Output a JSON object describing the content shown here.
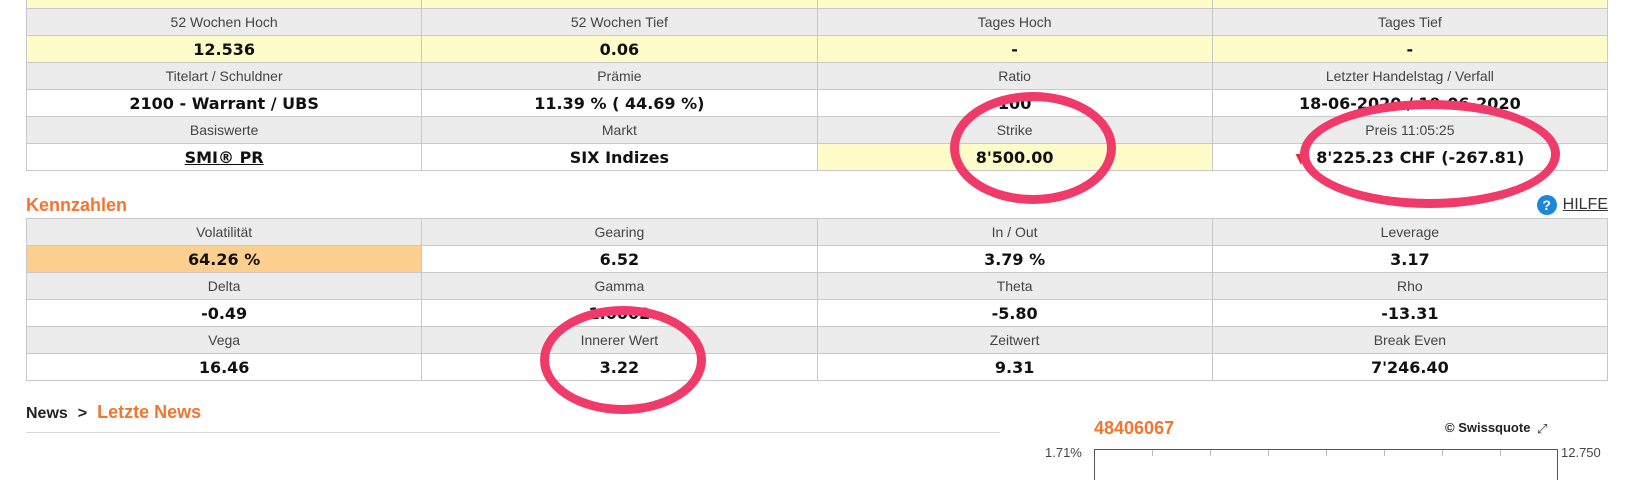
{
  "details": {
    "rows": [
      {
        "labels": [
          "52 Wochen Hoch",
          "52 Wochen Tief",
          "Tages Hoch",
          "Tages Tief"
        ],
        "values": [
          "12.536",
          "0.06",
          "-",
          "-"
        ]
      },
      {
        "labels": [
          "Titelart / Schuldner",
          "Prämie",
          "Ratio",
          "Letzter Handelstag / Verfall"
        ],
        "values": [
          "2100 - Warrant / UBS",
          "11.39 % ( 44.69 %)",
          "100",
          "18-06-2020 / 19-06-2020"
        ]
      },
      {
        "labels": [
          "Basiswerte",
          "Markt",
          "Strike",
          "Preis 11:05:25"
        ],
        "values": [
          "SMI® PR",
          "SIX Indizes",
          "8'500.00",
          "8'225.23 CHF (-267.81)"
        ]
      }
    ]
  },
  "kennzahlen": {
    "title": "Kennzahlen",
    "help_label": "HILFE",
    "help_icon": "question-icon",
    "rows": [
      {
        "labels": [
          "Volatilität",
          "Gearing",
          "In / Out",
          "Leverage"
        ],
        "values": [
          "64.26 %",
          "6.52",
          "3.79 %",
          "3.17"
        ]
      },
      {
        "labels": [
          "Delta",
          "Gamma",
          "Theta",
          "Rho"
        ],
        "values": [
          "-0.49",
          "1.0002",
          "-5.80",
          "-13.31"
        ]
      },
      {
        "labels": [
          "Vega",
          "Innerer Wert",
          "Zeitwert",
          "Break Even"
        ],
        "values": [
          "16.46",
          "3.22",
          "9.31",
          "7'246.40"
        ]
      }
    ]
  },
  "news": {
    "crumb": "News",
    "separator": ">",
    "current": "Letzte News"
  },
  "chart": {
    "id": "48406067",
    "source": "© Swissquote",
    "axis_left": "1.71%",
    "axis_right": "12.750"
  },
  "colors": {
    "accent": "#f4752f",
    "highlight_yellow": "#fefcc8",
    "highlight_orange": "#fdd08f",
    "annotation": "#f03a6a"
  }
}
